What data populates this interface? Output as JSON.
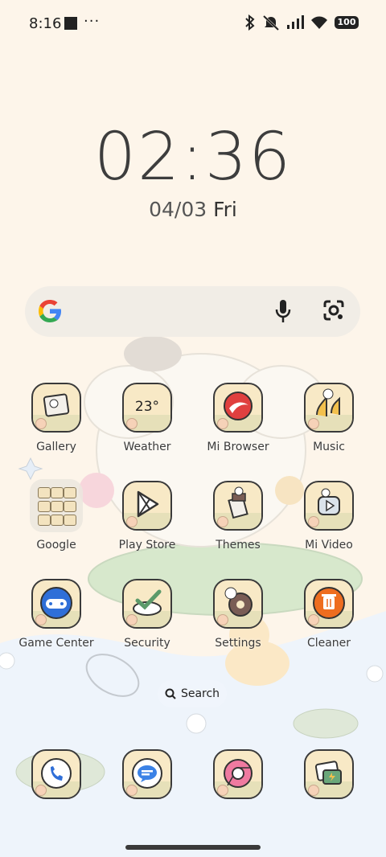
{
  "status_bar": {
    "time": "8:16",
    "dots": "···",
    "battery": "100"
  },
  "clock": {
    "time": "02:36",
    "date": "04/03",
    "day": "Fri"
  },
  "apps": {
    "gallery": "Gallery",
    "weather": "Weather",
    "weather_temp": "23°",
    "mi_browser": "Mi Browser",
    "music": "Music",
    "google": "Google",
    "play_store": "Play Store",
    "themes": "Themes",
    "mi_video": "Mi Video",
    "game_center": "Game Center",
    "security": "Security",
    "settings": "Settings",
    "cleaner": "Cleaner"
  },
  "search_pill": {
    "label": "Search"
  },
  "colors": {
    "background": "#fdf5ea",
    "water": "#eef4fb",
    "icon_bg": "#f8e9c6",
    "outline": "#3a3a3a"
  }
}
